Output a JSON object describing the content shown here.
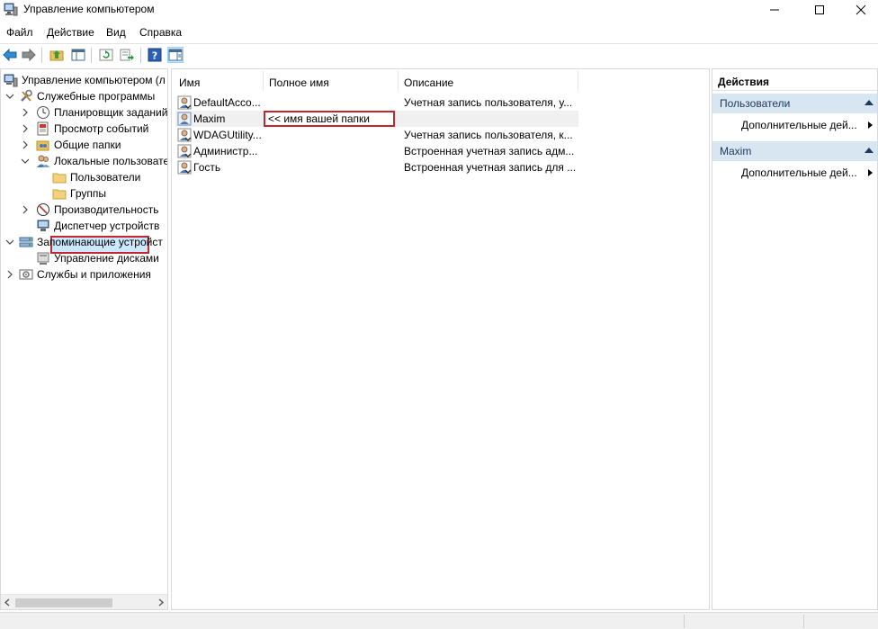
{
  "window": {
    "title": "Управление компьютером"
  },
  "menu": {
    "items": [
      "Файл",
      "Действие",
      "Вид",
      "Справка"
    ]
  },
  "tree": {
    "items": [
      {
        "label": "Управление компьютером (л"
      },
      {
        "label": "Служебные программы"
      },
      {
        "label": "Планировщик заданий"
      },
      {
        "label": "Просмотр событий"
      },
      {
        "label": "Общие папки"
      },
      {
        "label": "Локальные пользовате"
      },
      {
        "label": "Пользователи"
      },
      {
        "label": "Группы"
      },
      {
        "label": "Производительность"
      },
      {
        "label": "Диспетчер устройств"
      },
      {
        "label": "Запоминающие устройст"
      },
      {
        "label": "Управление дисками"
      },
      {
        "label": "Службы и приложения"
      }
    ]
  },
  "list": {
    "columns": [
      "Имя",
      "Полное имя",
      "Описание"
    ],
    "rows": [
      {
        "name": "DefaultAcco...",
        "fullname": "",
        "description": "Учетная запись пользователя, у..."
      },
      {
        "name": "Maxim",
        "fullname": "<< имя вашей папки",
        "description": ""
      },
      {
        "name": "WDAGUtility...",
        "fullname": "",
        "description": "Учетная запись пользователя, к..."
      },
      {
        "name": "Администр...",
        "fullname": "",
        "description": "Встроенная учетная запись адм..."
      },
      {
        "name": "Гость",
        "fullname": "",
        "description": "Встроенная учетная запись для ..."
      }
    ]
  },
  "actions": {
    "header": "Действия",
    "groups": [
      {
        "title": "Пользователи",
        "item": "Дополнительные дей..."
      },
      {
        "title": "Maxim",
        "item": "Дополнительные дей..."
      }
    ]
  },
  "colors": {
    "annotation": "#c0282f",
    "selection": "#cce8ff",
    "group_header": "#d8e6f2"
  }
}
